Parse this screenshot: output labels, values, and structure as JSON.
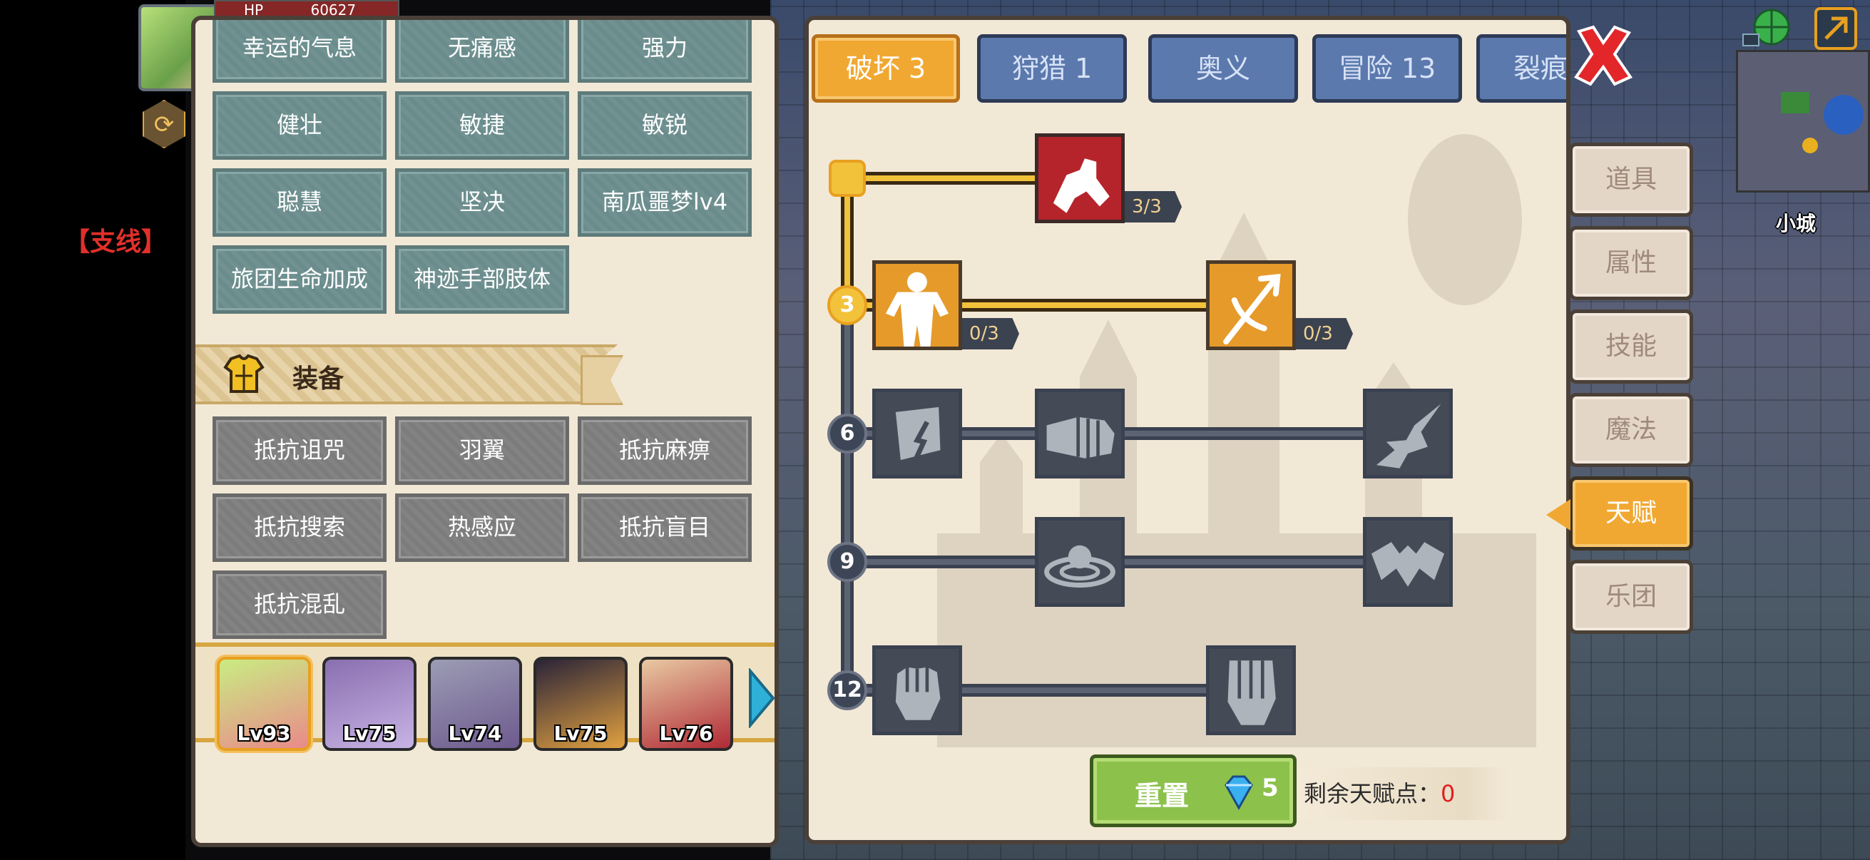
{
  "hud": {
    "hp_label": "HP",
    "hp_value": "60627",
    "side_quest": "【支线】",
    "town_name": "小城"
  },
  "left_panel": {
    "passive_skills": [
      {
        "label": "幸运的气息"
      },
      {
        "label": "无痛感"
      },
      {
        "label": "强力"
      },
      {
        "label": "健壮"
      },
      {
        "label": "敏捷"
      },
      {
        "label": "敏锐"
      },
      {
        "label": "聪慧"
      },
      {
        "label": "坚决"
      },
      {
        "label": "南瓜噩梦lv4"
      },
      {
        "label": "旅团生命加成"
      },
      {
        "label": "神迹手部肢体"
      }
    ],
    "equipment_section": {
      "title": "装备",
      "icon": "armor-icon"
    },
    "equipment_skills": [
      {
        "label": "抵抗诅咒"
      },
      {
        "label": "羽翼"
      },
      {
        "label": "抵抗麻痹"
      },
      {
        "label": "抵抗搜索"
      },
      {
        "label": "热感应"
      },
      {
        "label": "抵抗盲目"
      },
      {
        "label": "抵抗混乱"
      }
    ],
    "party": [
      {
        "level": "Lv93",
        "selected": true,
        "colors": [
          "#c9ec82",
          "#e98a8a"
        ]
      },
      {
        "level": "Lv75",
        "selected": false,
        "colors": [
          "#8a6fb0",
          "#c7b3e4"
        ]
      },
      {
        "level": "Lv74",
        "selected": false,
        "colors": [
          "#9c9cb4",
          "#6d5a8e"
        ]
      },
      {
        "level": "Lv75",
        "selected": false,
        "colors": [
          "#2b2438",
          "#e0a040"
        ]
      },
      {
        "level": "Lv76",
        "selected": false,
        "colors": [
          "#e8c9a2",
          "#b02a36"
        ]
      }
    ]
  },
  "talent_panel": {
    "tabs": [
      {
        "label": "破坏 3",
        "active": true
      },
      {
        "label": "狩猎 1",
        "active": false
      },
      {
        "label": "奥义",
        "active": false
      },
      {
        "label": "冒险 13",
        "active": false
      },
      {
        "label": "裂痕",
        "active": false
      }
    ],
    "rows": [
      {
        "level": "",
        "nodes": [
          {
            "icon": "arm-wrestle-icon",
            "rank": "3/3",
            "state": "maxed"
          }
        ]
      },
      {
        "level": "3",
        "nodes": [
          {
            "icon": "body-strength-icon",
            "rank": "0/3",
            "state": "available"
          },
          {
            "icon": "piercing-arrow-icon",
            "rank": "0/3",
            "state": "available"
          }
        ]
      },
      {
        "level": "6",
        "nodes": [
          {
            "icon": "shield-break-icon",
            "state": "locked"
          },
          {
            "icon": "punch-icon",
            "state": "locked"
          },
          {
            "icon": "splash-strike-icon",
            "state": "locked"
          }
        ]
      },
      {
        "level": "9",
        "nodes": [
          {
            "icon": "ripple-icon",
            "state": "locked"
          },
          {
            "icon": "bat-wing-icon",
            "state": "locked"
          }
        ]
      },
      {
        "level": "12",
        "nodes": [
          {
            "icon": "fist-icon",
            "state": "locked"
          },
          {
            "icon": "gauntlet-icon",
            "state": "locked"
          }
        ]
      }
    ],
    "reset_button": {
      "label": "重置",
      "cost": "5",
      "cost_icon": "diamond-icon"
    },
    "remaining": {
      "label": "剩余天赋点：",
      "value": "0"
    }
  },
  "side_menu": [
    {
      "label": "道具",
      "active": false
    },
    {
      "label": "属性",
      "active": false
    },
    {
      "label": "技能",
      "active": false
    },
    {
      "label": "魔法",
      "active": false
    },
    {
      "label": "天赋",
      "active": true
    },
    {
      "label": "乐团",
      "active": false
    }
  ],
  "colors": {
    "accent_orange": "#f1a832",
    "active_line": "#f2c23a",
    "inactive_node": "#454b56",
    "remaining_value": "#e02020",
    "reset_green": "#8cc14c"
  }
}
